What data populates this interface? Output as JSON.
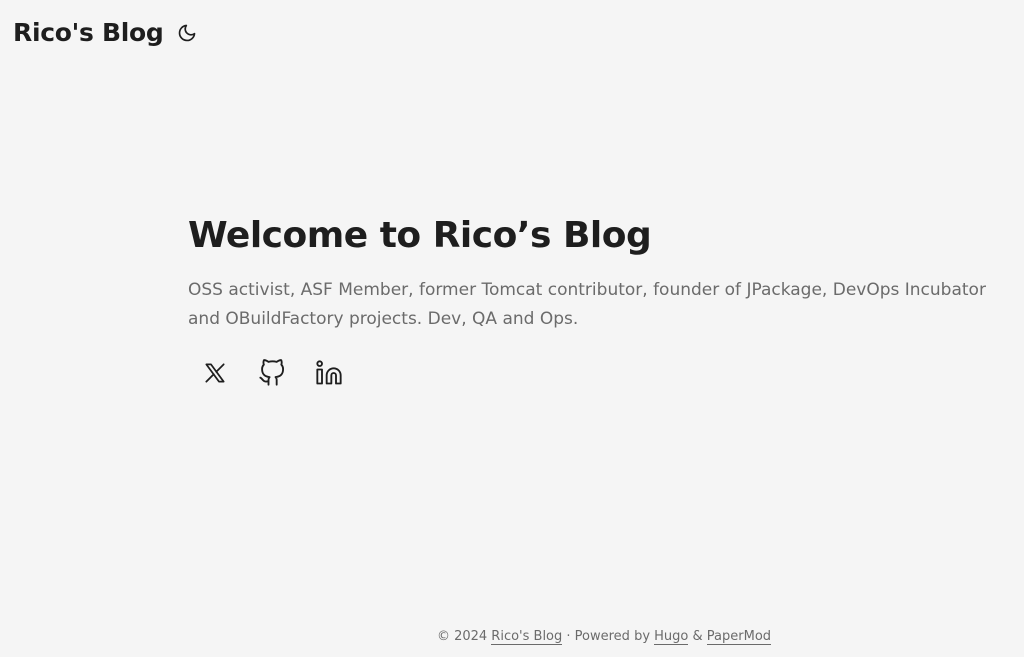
{
  "header": {
    "logo": "Rico's Blog",
    "theme_toggle_icon": "moon-icon"
  },
  "hero": {
    "title": "Welcome to Rico’s Blog",
    "description": "OSS activist, ASF Member, former Tomcat contributor, founder of JPackage, DevOps Incubator and OBuildFactory projects. Dev, QA and Ops."
  },
  "social": [
    {
      "icon": "x-twitter-icon"
    },
    {
      "icon": "github-icon"
    },
    {
      "icon": "linkedin-icon"
    }
  ],
  "footer": {
    "copyright": "© 2024 ",
    "site_link": "Rico's Blog",
    "powered_by": " · Powered by ",
    "hugo_link": "Hugo",
    "amp": " & ",
    "theme_link": "PaperMod"
  },
  "colors": {
    "background": "#f5f5f5",
    "text": "#1e1e1e",
    "secondary": "#6b6b6b"
  }
}
